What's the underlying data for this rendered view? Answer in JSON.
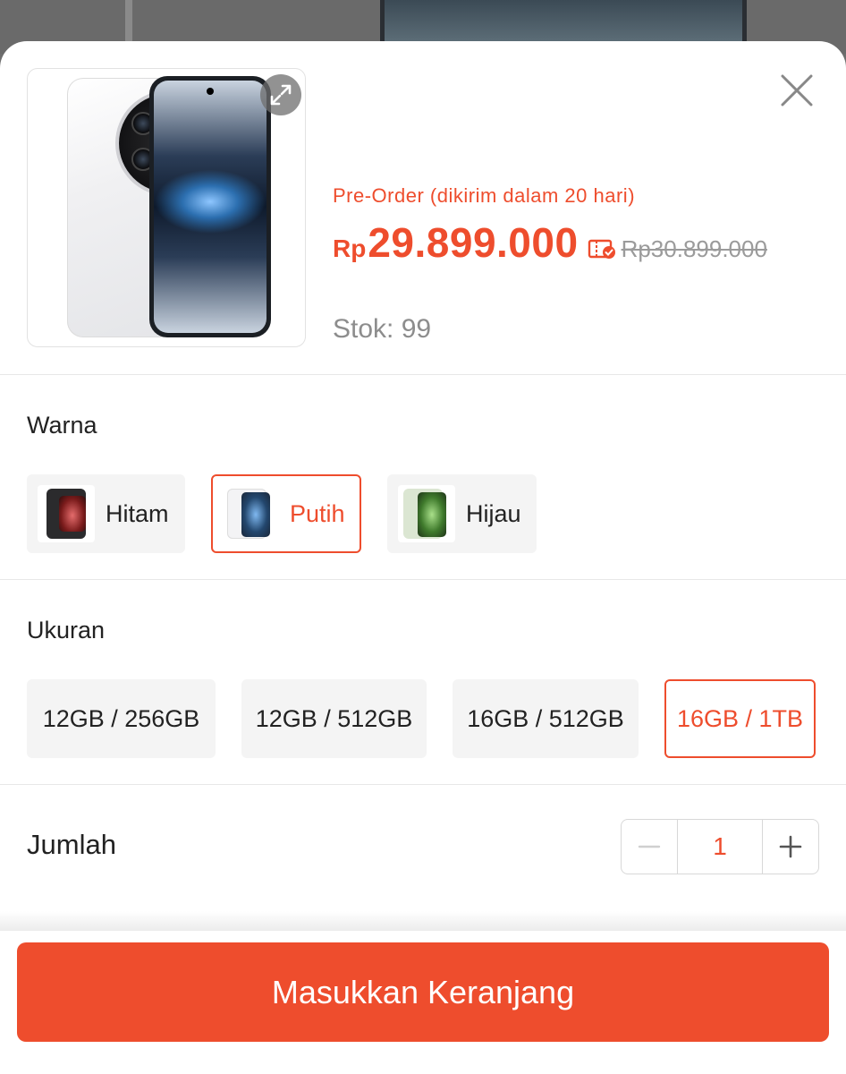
{
  "product": {
    "preorder_text": "Pre-Order (dikirim dalam 20 hari)",
    "currency": "Rp",
    "price": "29.899.000",
    "original_price": "Rp30.899.000",
    "stock_text": "Stok: 99",
    "image_icon": "phone-product-image"
  },
  "icons": {
    "close": "close-icon",
    "expand": "expand-icon",
    "voucher": "voucher-check-icon",
    "minus": "minus-icon",
    "plus": "plus-icon"
  },
  "color_section": {
    "label": "Warna",
    "options": [
      {
        "label": "Hitam",
        "selected": false,
        "swatch": "#2b2b2d"
      },
      {
        "label": "Putih",
        "selected": true,
        "swatch": "#ffffff"
      },
      {
        "label": "Hijau",
        "selected": false,
        "swatch": "#9dbf8a"
      }
    ]
  },
  "size_section": {
    "label": "Ukuran",
    "options": [
      {
        "label": "12GB / 256GB",
        "selected": false
      },
      {
        "label": "12GB / 512GB",
        "selected": false
      },
      {
        "label": "16GB / 512GB",
        "selected": false
      },
      {
        "label": "16GB / 1TB",
        "selected": true
      }
    ]
  },
  "quantity": {
    "label": "Jumlah",
    "value": "1"
  },
  "cta": {
    "label": "Masukkan Keranjang"
  },
  "colors": {
    "accent": "#ee4d2d",
    "chip_bg": "#f4f4f4",
    "muted_text": "#8d8d8d"
  }
}
